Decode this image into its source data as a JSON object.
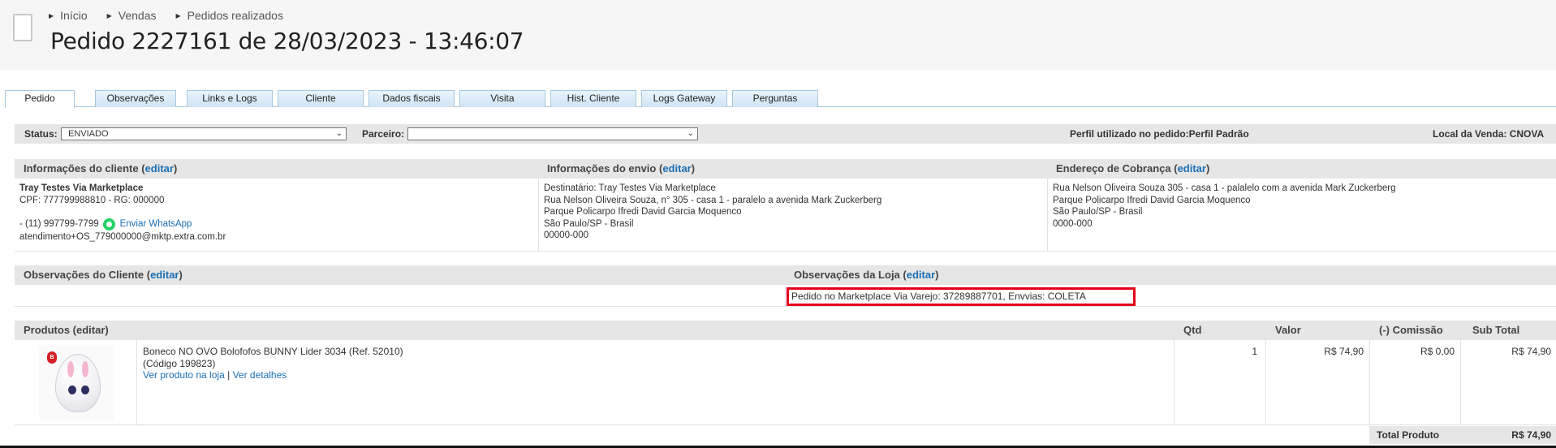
{
  "breadcrumb": [
    "Início",
    "Vendas",
    "Pedidos realizados"
  ],
  "page_title": "Pedido 2227161 de 28/03/2023 - 13:46:07",
  "tabs": [
    "Pedido",
    "Observações",
    "Links e Logs",
    "Cliente",
    "Dados fiscais",
    "Visita",
    "Hist. Cliente",
    "Logs Gateway",
    "Perguntas"
  ],
  "active_tab": "Pedido",
  "status_bar": {
    "status_label": "Status:",
    "status_value": "ENVIADO",
    "partner_label": "Parceiro:",
    "partner_value": "",
    "profile_text": "Perfil utilizado no pedido:Perfil Padrão",
    "sale_location_text": "Local da Venda: CNOVA"
  },
  "edit_label": "editar",
  "customer": {
    "title": "Informações do cliente",
    "name": "Tray Testes Via Marketplace",
    "doc": "CPF: 777799988810 - RG: 000000",
    "phone": "- (11) 997799-7799",
    "whatsapp_label": "Enviar WhatsApp",
    "email": "atendimento+OS_779000000@mktp.extra.com.br"
  },
  "shipping": {
    "title": "Informações do envio",
    "lines": [
      "Destinatário: Tray Testes Via Marketplace",
      "Rua Nelson Oliveira Souza, n° 305 - casa 1 - paralelo a avenida Mark Zuckerberg",
      "Parque Policarpo Ifredi David Garcia Moquenco",
      "São Paulo/SP - Brasil",
      "00000-000"
    ]
  },
  "billing": {
    "title": "Endereço de Cobrança",
    "lines": [
      "Rua Nelson Oliveira Souza 305 - casa 1 - palalelo com a avenida Mark Zuckerberg",
      "Parque Policarpo Ifredi David Garcia Moquenco",
      "São Paulo/SP - Brasil",
      "0000-000"
    ]
  },
  "observations": {
    "client_title": "Observações do Cliente",
    "store_title": "Observações da Loja",
    "client_text": "",
    "store_text": "Pedido no Marketplace Via Varejo: 37289887701, Envvias: COLETA"
  },
  "products": {
    "title": "Produtos",
    "columns": [
      "Qtd",
      "Valor",
      "(-) Comissão",
      "Sub Total"
    ],
    "items": [
      {
        "name": "Boneco NO OVO Bolofofos BUNNY Lider 3034 (Ref. 52010)",
        "code": "(Código 199823)",
        "view_link": "Ver produto na loja",
        "separator": "|",
        "details_link": "Ver detalhes",
        "qty": "1",
        "value": "R$ 74,90",
        "commission": "R$ 0,00",
        "subtotal": "R$ 74,90"
      }
    ],
    "total_label": "Total Produto",
    "total_value": "R$ 74,90"
  },
  "icons": {
    "page": "document-icon",
    "crumb": "triangle-right-icon",
    "whatsapp": "whatsapp-icon",
    "dropdown": "chevron-down-icon"
  },
  "colors": {
    "link": "#1a6fb5",
    "highlight_border": "#e3001b",
    "whatsapp": "#25d366",
    "tab_border": "#a8c8e0"
  }
}
